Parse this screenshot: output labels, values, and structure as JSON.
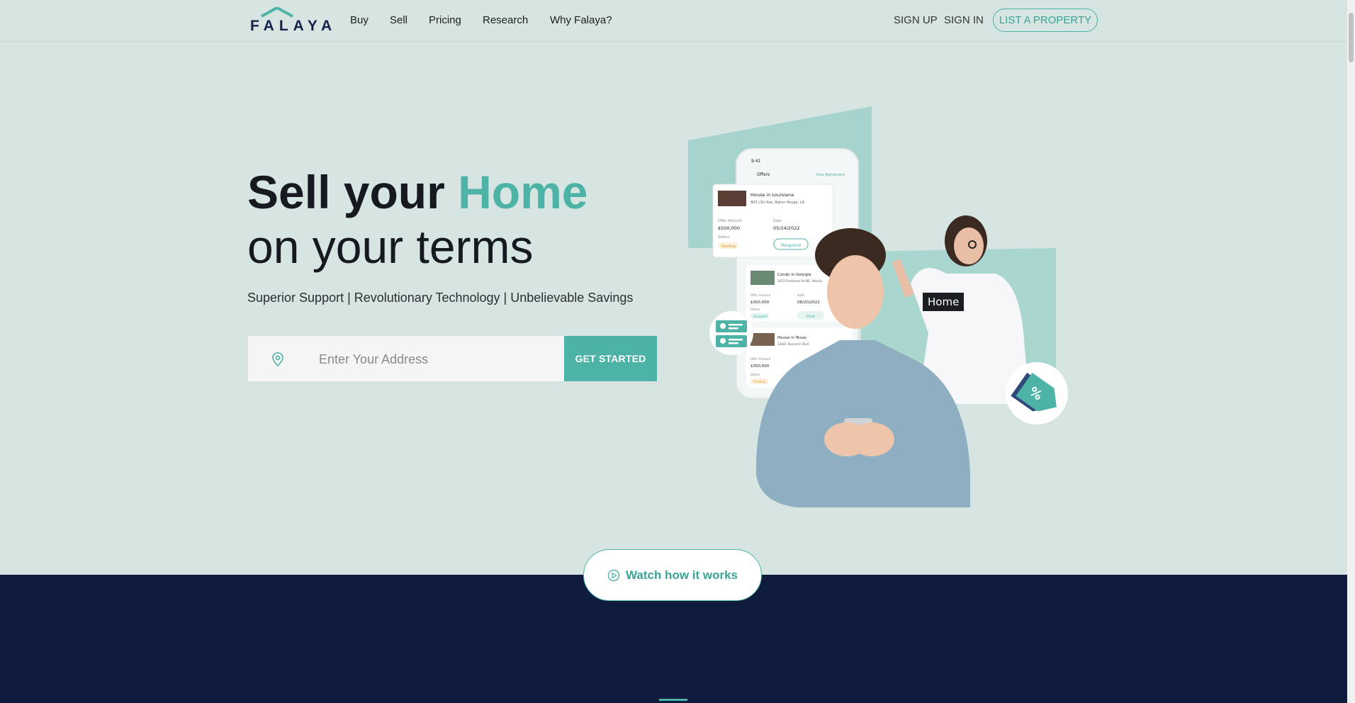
{
  "brand": {
    "name": "FALAYA"
  },
  "nav": {
    "items": [
      "Buy",
      "Sell",
      "Pricing",
      "Research",
      "Why Falaya?"
    ]
  },
  "auth": {
    "sign_up": "SIGN UP",
    "sign_in": "SIGN IN",
    "list_property": "LIST A PROPERTY"
  },
  "hero": {
    "title_prefix": "Sell your ",
    "title_accent": "Home",
    "title_second": "on your terms",
    "tagline": "Superior Support | Revolutionary Technology | Unbelievable Savings",
    "address_placeholder": "Enter Your Address",
    "cta": "GET STARTED"
  },
  "tooltip": {
    "text": "Home"
  },
  "phone": {
    "time": "9:41",
    "header": "Offers",
    "header_link": "View Agreement",
    "card1": {
      "title": "House in Louisiana",
      "address": "800 LSU Ave, Baton Rouge, LA",
      "offer_label": "Offer Amount",
      "offer": "$500,000",
      "date_label": "Date",
      "date": "05/24/2022",
      "status_label": "Status",
      "status": "Pending",
      "action": "Respond"
    },
    "card2": {
      "title": "Condo in Georgia",
      "address": "3423 Piedmont Rd NE, Atlanta",
      "offer_label": "Offer Amount",
      "offer": "$300,000",
      "date_label": "Date",
      "date": "08/20/2022",
      "status_label": "Status",
      "status": "Accepted",
      "action": "View"
    },
    "card3": {
      "title": "House in Texas",
      "address": "12841 Research Blvd",
      "offer_label": "Offer Amount",
      "offer": "$300,000",
      "status_label": "Status",
      "status": "Pending"
    }
  },
  "watch": {
    "label": "Watch how it works"
  },
  "colors": {
    "accent": "#4db3a7",
    "navy": "#0f1c3e",
    "bg": "#d6e4e2"
  }
}
